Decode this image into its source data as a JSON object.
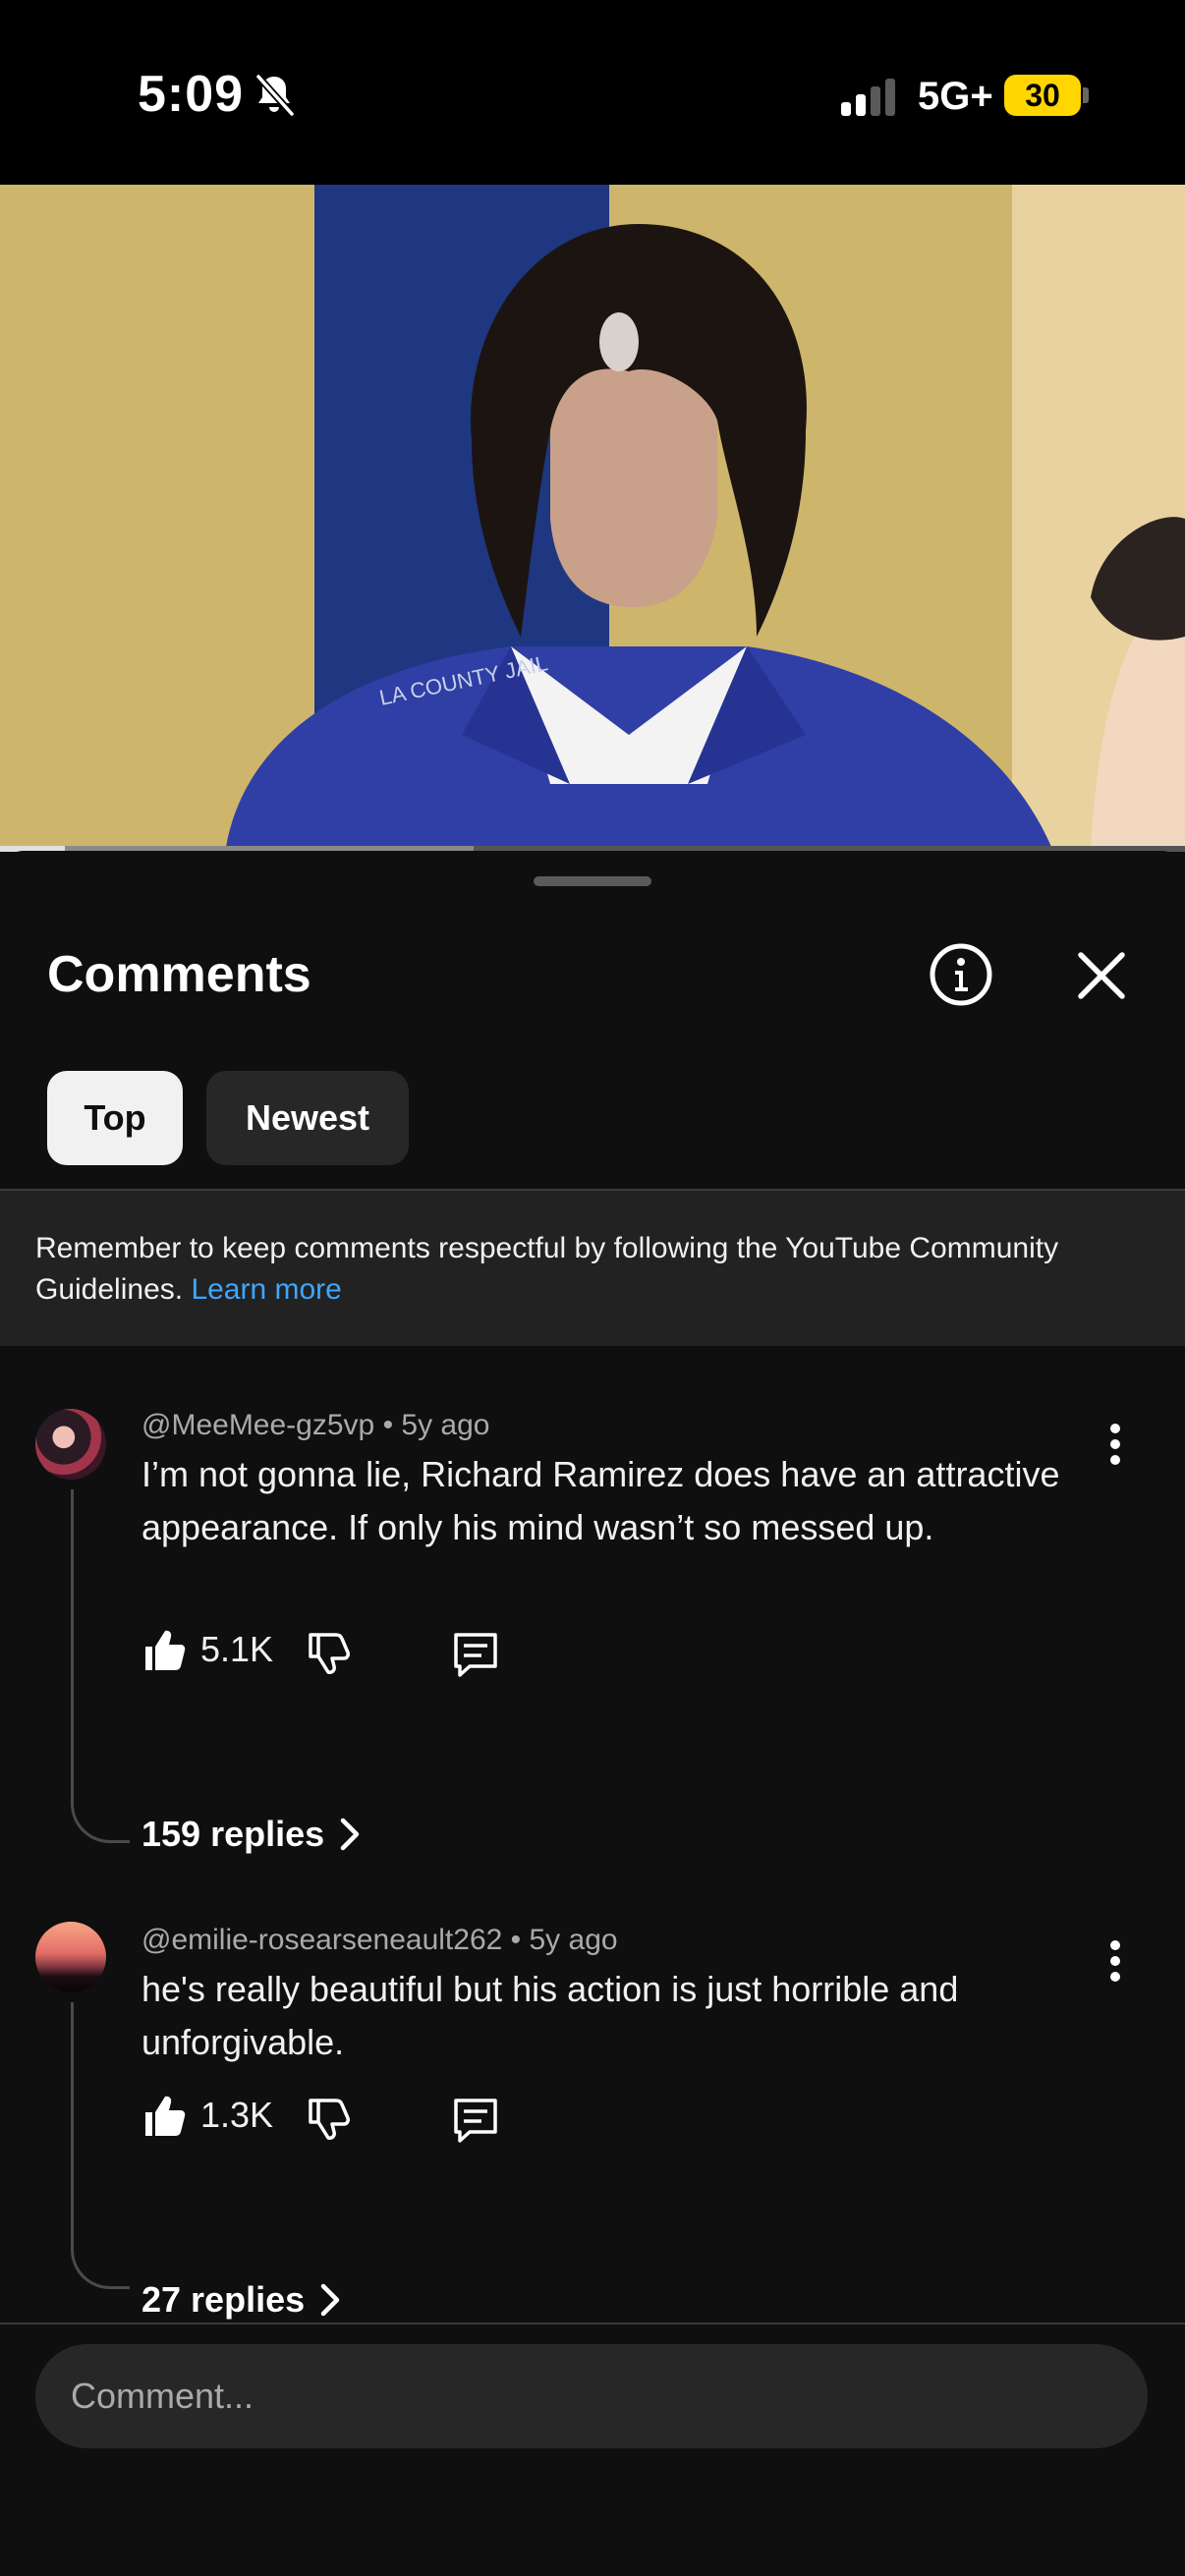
{
  "status_bar": {
    "time": "5:09",
    "network": "5G+",
    "battery": "30",
    "icons": [
      "bell-slash-icon",
      "cellular-signal-icon",
      "battery-icon"
    ],
    "battery_color": "#ffd600"
  },
  "video": {
    "progress_fraction": 0.055,
    "buffered_fraction": 0.4
  },
  "comments_sheet": {
    "title": "Comments",
    "icons": [
      "info-icon",
      "close-icon"
    ],
    "filters": [
      {
        "label": "Top",
        "selected": true
      },
      {
        "label": "Newest",
        "selected": false
      }
    ],
    "guidelines": {
      "text": "Remember to keep comments respectful by following the YouTube Community Guidelines. ",
      "link": "Learn more",
      "link_color": "#3ea6ff"
    },
    "comments": [
      {
        "author": "@MeeMee-gz5vp",
        "age": "5y ago",
        "text": "I’m not gonna lie, Richard Ramirez does have an attractive appearance. If only his mind wasn’t so messed up.",
        "likes": "5.1K",
        "replies": "159 replies"
      },
      {
        "author": "@emilie-rosearseneault262",
        "age": "5y ago",
        "text": "he's really beautiful but his action is just horrible and unforgivable.",
        "likes": "1.3K",
        "replies": "27 replies"
      }
    ],
    "composer": {
      "placeholder": "Comment..."
    }
  }
}
